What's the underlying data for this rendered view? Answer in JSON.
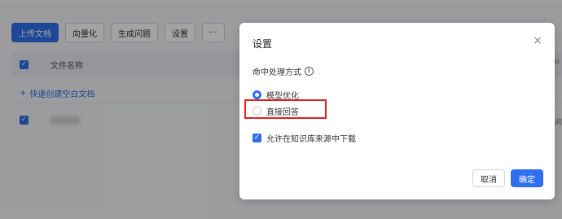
{
  "toolbar": {
    "buttons": [
      "上传文档",
      "向量化",
      "生成问题",
      "设置",
      "···"
    ]
  },
  "table": {
    "header_label": "文件名称",
    "quick_create": "快速创建空白文档",
    "right_cut_header": "o",
    "right_cut_row": "问"
  },
  "dialog": {
    "title": "设置",
    "close_icon": "×",
    "field_label": "命中处理方式",
    "info_icon": "i",
    "options": [
      {
        "label": "模型优化",
        "selected": true
      },
      {
        "label": "直接回答",
        "selected": false
      }
    ],
    "allow_download_label": "允许在知识库来源中下载",
    "allow_download_checked": true,
    "cancel": "取消",
    "confirm": "确定"
  },
  "colors": {
    "primary": "#2f6fed",
    "highlight": "#e02020"
  }
}
